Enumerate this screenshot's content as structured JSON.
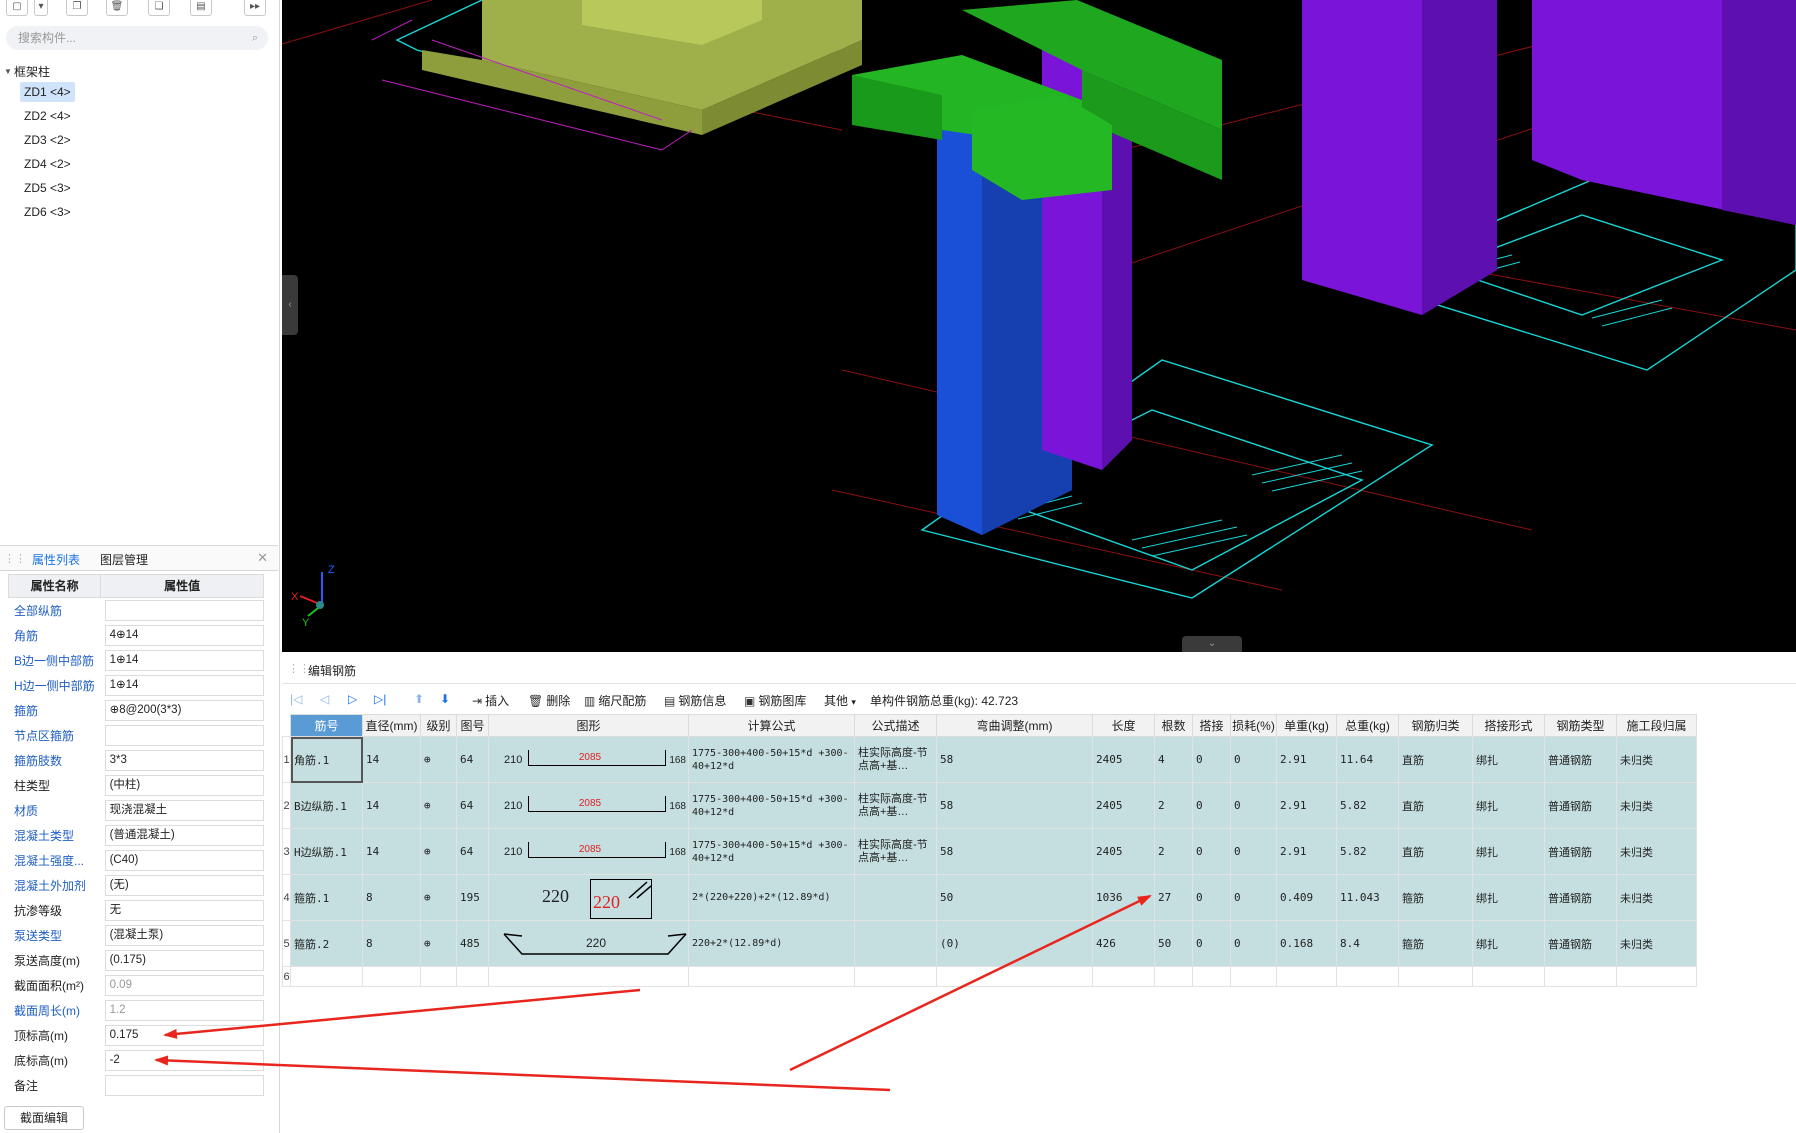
{
  "search": {
    "placeholder": "搜索构件..."
  },
  "tree": {
    "root": "框架柱",
    "items": [
      "ZD1 <4>",
      "ZD2 <4>",
      "ZD3 <2>",
      "ZD4 <2>",
      "ZD5 <3>",
      "ZD6 <3>"
    ],
    "selected_index": 0
  },
  "props": {
    "tabs": [
      "属性列表",
      "图层管理"
    ],
    "headers": [
      "属性名称",
      "属性值"
    ],
    "rows": [
      {
        "name": "全部纵筋",
        "value": ""
      },
      {
        "name": "角筋",
        "value": "4⊕14"
      },
      {
        "name": "B边一侧中部筋",
        "value": "1⊕14"
      },
      {
        "name": "H边一侧中部筋",
        "value": "1⊕14"
      },
      {
        "name": "箍筋",
        "value": "⊕8@200(3*3)"
      },
      {
        "name": "节点区箍筋",
        "value": ""
      },
      {
        "name": "箍筋肢数",
        "value": "3*3"
      },
      {
        "name": "柱类型",
        "value": "(中柱)"
      },
      {
        "name": "材质",
        "value": "现浇混凝土"
      },
      {
        "name": "混凝土类型",
        "value": "(普通混凝土)"
      },
      {
        "name": "混凝土强度...",
        "value": "(C40)"
      },
      {
        "name": "混凝土外加剂",
        "value": "(无)"
      },
      {
        "name": "抗渗等级",
        "value": "无"
      },
      {
        "name": "泵送类型",
        "value": "(混凝土泵)"
      },
      {
        "name": "泵送高度(m)",
        "value": "(0.175)"
      },
      {
        "name": "截面面积(m²)",
        "value": "0.09"
      },
      {
        "name": "截面周长(m)",
        "value": "1.2"
      },
      {
        "name": "顶标高(m)",
        "value": "0.175"
      },
      {
        "name": "底标高(m)",
        "value": "-2"
      },
      {
        "name": "备注",
        "value": ""
      }
    ],
    "section_edit": "截面编辑"
  },
  "editor": {
    "title": "编辑钢筋",
    "tools": {
      "insert": "插入",
      "delete": "删除",
      "scale": "缩尺配筋",
      "info": "钢筋信息",
      "library": "钢筋图库",
      "other": "其他",
      "total": "单构件钢筋总重(kg): 42.723"
    },
    "columns": [
      "筋号",
      "直径(mm)",
      "级别",
      "图号",
      "图形",
      "计算公式",
      "公式描述",
      "弯曲调整(mm)",
      "长度",
      "根数",
      "搭接",
      "损耗(%)",
      "单重(kg)",
      "总重(kg)",
      "钢筋归类",
      "搭接形式",
      "钢筋类型",
      "施工段归属"
    ],
    "rows": [
      {
        "no": "1",
        "name": "角筋.1",
        "dia": "14",
        "grade": "⊕",
        "fig": "64",
        "shape_l": "210",
        "shape_m": "2085",
        "shape_r": "168",
        "formula": "1775-300+400-50+15*d +300-40+12*d",
        "desc": "柱实际高度-节点高+基…",
        "bend": "58",
        "len": "2405",
        "count": "4",
        "lap": "0",
        "loss": "0",
        "unit": "2.91",
        "total": "11.64",
        "cat": "直筋",
        "lapform": "绑扎",
        "type": "普通钢筋",
        "stage": "未归类"
      },
      {
        "no": "2",
        "name": "B边纵筋.1",
        "dia": "14",
        "grade": "⊕",
        "fig": "64",
        "shape_l": "210",
        "shape_m": "2085",
        "shape_r": "168",
        "formula": "1775-300+400-50+15*d +300-40+12*d",
        "desc": "柱实际高度-节点高+基…",
        "bend": "58",
        "len": "2405",
        "count": "2",
        "lap": "0",
        "loss": "0",
        "unit": "2.91",
        "total": "5.82",
        "cat": "直筋",
        "lapform": "绑扎",
        "type": "普通钢筋",
        "stage": "未归类"
      },
      {
        "no": "3",
        "name": "H边纵筋.1",
        "dia": "14",
        "grade": "⊕",
        "fig": "64",
        "shape_l": "210",
        "shape_m": "2085",
        "shape_r": "168",
        "formula": "1775-300+400-50+15*d +300-40+12*d",
        "desc": "柱实际高度-节点高+基…",
        "bend": "58",
        "len": "2405",
        "count": "2",
        "lap": "0",
        "loss": "0",
        "unit": "2.91",
        "total": "5.82",
        "cat": "直筋",
        "lapform": "绑扎",
        "type": "普通钢筋",
        "stage": "未归类"
      },
      {
        "no": "4",
        "name": "箍筋.1",
        "dia": "8",
        "grade": "⊕",
        "fig": "195",
        "stir_l": "220",
        "stir_r": "220",
        "formula": "2*(220+220)+2*(12.89*d)",
        "desc": "",
        "bend": "50",
        "len": "1036",
        "count": "27",
        "lap": "0",
        "loss": "0",
        "unit": "0.409",
        "total": "11.043",
        "cat": "箍筋",
        "lapform": "绑扎",
        "type": "普通钢筋",
        "stage": "未归类"
      },
      {
        "no": "5",
        "name": "箍筋.2",
        "dia": "8",
        "grade": "⊕",
        "fig": "485",
        "tie": "220",
        "formula": "220+2*(12.89*d)",
        "desc": "",
        "bend": "(0)",
        "len": "426",
        "count": "50",
        "lap": "0",
        "loss": "0",
        "unit": "0.168",
        "total": "8.4",
        "cat": "箍筋",
        "lapform": "绑扎",
        "type": "普通钢筋",
        "stage": "未归类"
      }
    ],
    "empty_row_no": "6"
  },
  "axes": {
    "x": "X",
    "y": "Y",
    "z": "Z"
  },
  "colors": {
    "accent": "#1a73e8",
    "row_bg": "#c5dfe1",
    "arrow": "#e8261e"
  }
}
